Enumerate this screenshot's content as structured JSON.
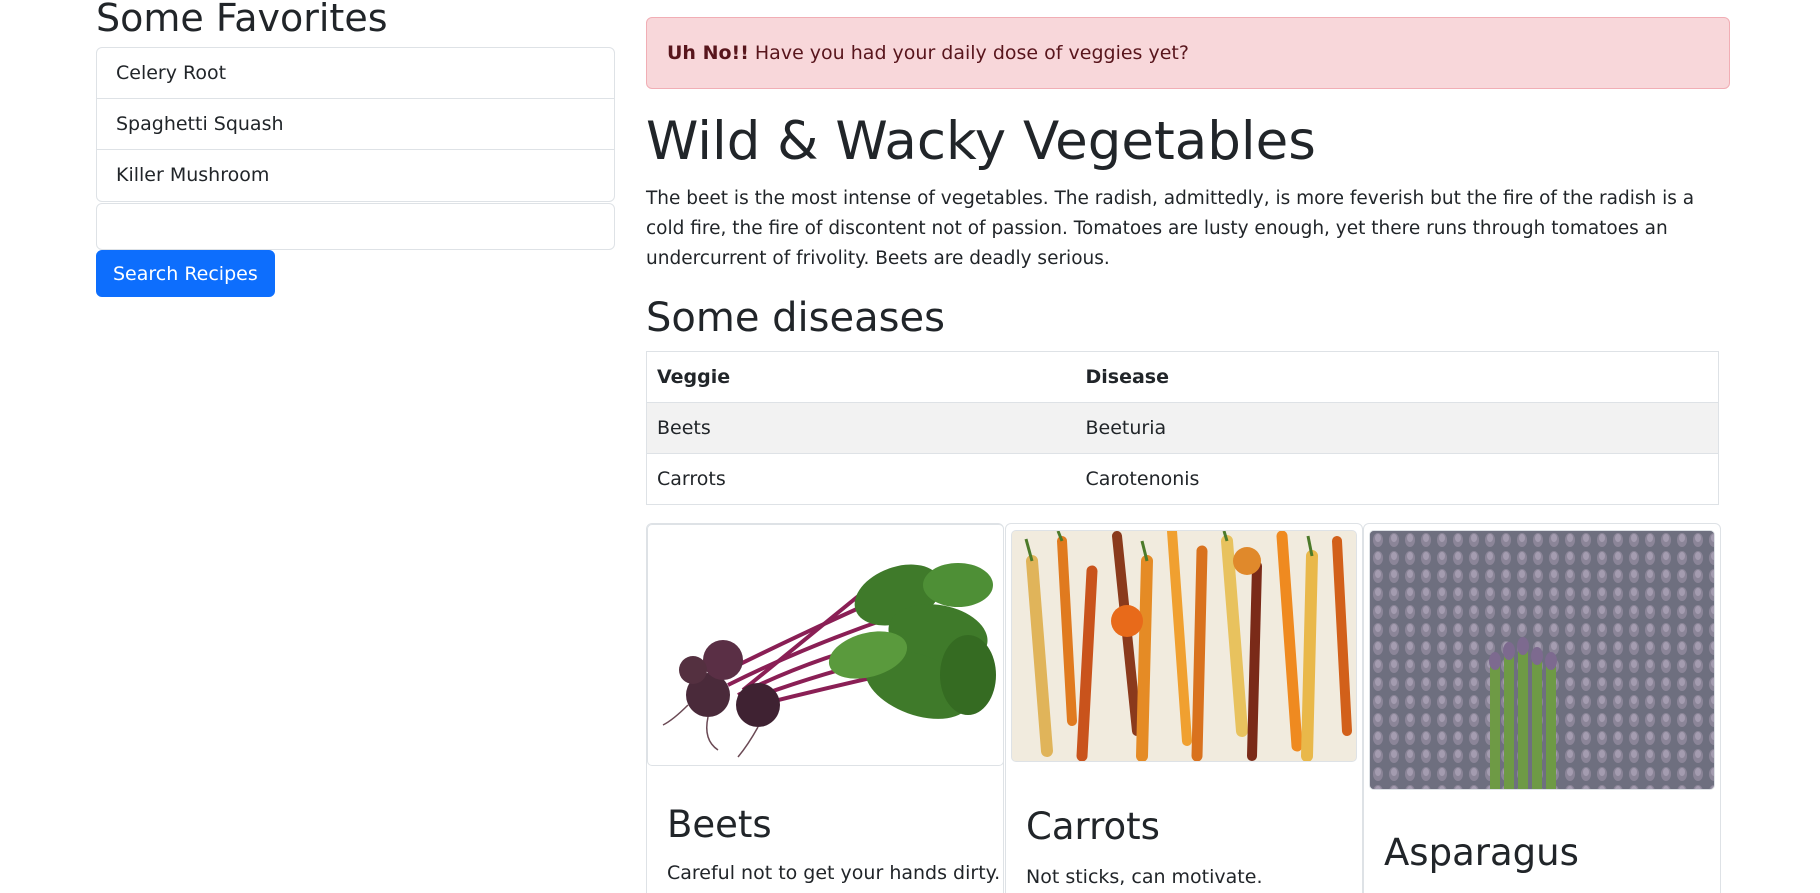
{
  "sidebar": {
    "title": "Some Favorites",
    "items": [
      {
        "label": "Celery Root"
      },
      {
        "label": "Spaghetti Squash"
      },
      {
        "label": "Killer Mushroom"
      }
    ],
    "search_value": "",
    "search_button": "Search Recipes"
  },
  "alert": {
    "strong": "Uh No!!",
    "text": " Have you had your daily dose of veggies yet?"
  },
  "main": {
    "title": "Wild & Wacky Vegetables",
    "lead": "The beet is the most intense of vegetables. The radish, admittedly, is more feverish but the fire of the radish is a cold fire, the fire of discontent not of passion. Tomatoes are lusty enough, yet there runs through tomatoes an undercurrent of frivolity. Beets are deadly serious.",
    "diseases_title": "Some diseases",
    "table": {
      "headers": [
        "Veggie",
        "Disease"
      ],
      "rows": [
        [
          "Beets",
          "Beeturia"
        ],
        [
          "Carrots",
          "Carotenonis"
        ]
      ]
    }
  },
  "cards": [
    {
      "title": "Beets",
      "text": "Careful not to get your hands dirty.",
      "image": "beets-photo"
    },
    {
      "title": "Carrots",
      "text": "Not sticks, can motivate.",
      "image": "carrots-photo"
    },
    {
      "title": "Asparagus",
      "text": "",
      "image": "asparagus-photo"
    }
  ],
  "colors": {
    "primary": "#0d6efd",
    "alert_bg": "#f8d7da",
    "alert_text": "#58151c"
  }
}
